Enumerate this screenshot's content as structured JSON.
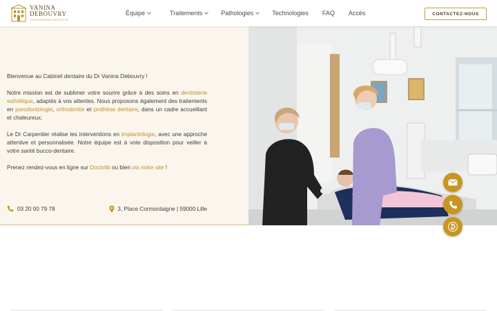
{
  "header": {
    "logo": {
      "name_line1": "VANINA",
      "name_line2": "DEBOUVRY",
      "subtitle": "CHIRURGIEN-DENTISTE"
    },
    "nav": [
      {
        "label": "Équipe",
        "has_dropdown": true
      },
      {
        "label": "Traitements",
        "has_dropdown": true
      },
      {
        "label": "Pathologies",
        "has_dropdown": true
      },
      {
        "label": "Technologies",
        "has_dropdown": false
      },
      {
        "label": "FAQ",
        "has_dropdown": false
      },
      {
        "label": "Accès",
        "has_dropdown": false
      }
    ],
    "contact_button": "CONTACTEZ-NOUS"
  },
  "hero": {
    "welcome": "Bienvenue au Cabinet dentaire du Dr Vanina Debouvry !",
    "p2_part1": "Notre mission est de sublimer votre sourire grâce à des soins en ",
    "p2_link1": "dentisterie esthétique",
    "p2_part2": ", adaptés à vos attentes. Nous proposons également des traitements en ",
    "p2_link2": "parodontologie",
    "p2_part3": ", ",
    "p2_link3": "orthodontie",
    "p2_part4": " et ",
    "p2_link4": "prothèse dentaire",
    "p2_part5": ", dans un cadre accueillant et chaleureux.",
    "p3_part1": "Le Dr Carpentier réalise les interventions en ",
    "p3_link1": "implantologie",
    "p3_part2": ", avec une approche attentive et personnalisée. Notre équipe est à vote disposition pour veiller à votre santé bucco-dentaire.",
    "p4_part1": "Prenez rendez-vous en ligne sur ",
    "p4_link1": "Doctolib",
    "p4_part2": " ou bien ",
    "p4_link2": "via notre site",
    "p4_part3": " !",
    "phone": "03 20 00 79 78",
    "address": "3, Place Cormontaigne | 59000 Lille"
  },
  "floating_buttons": [
    {
      "icon": "mail-icon"
    },
    {
      "icon": "phone-icon"
    },
    {
      "icon": "doctolib-icon"
    }
  ],
  "colors": {
    "accent": "#c8961f",
    "link": "#c18e2a",
    "hero_bg": "#fbf6ed"
  }
}
